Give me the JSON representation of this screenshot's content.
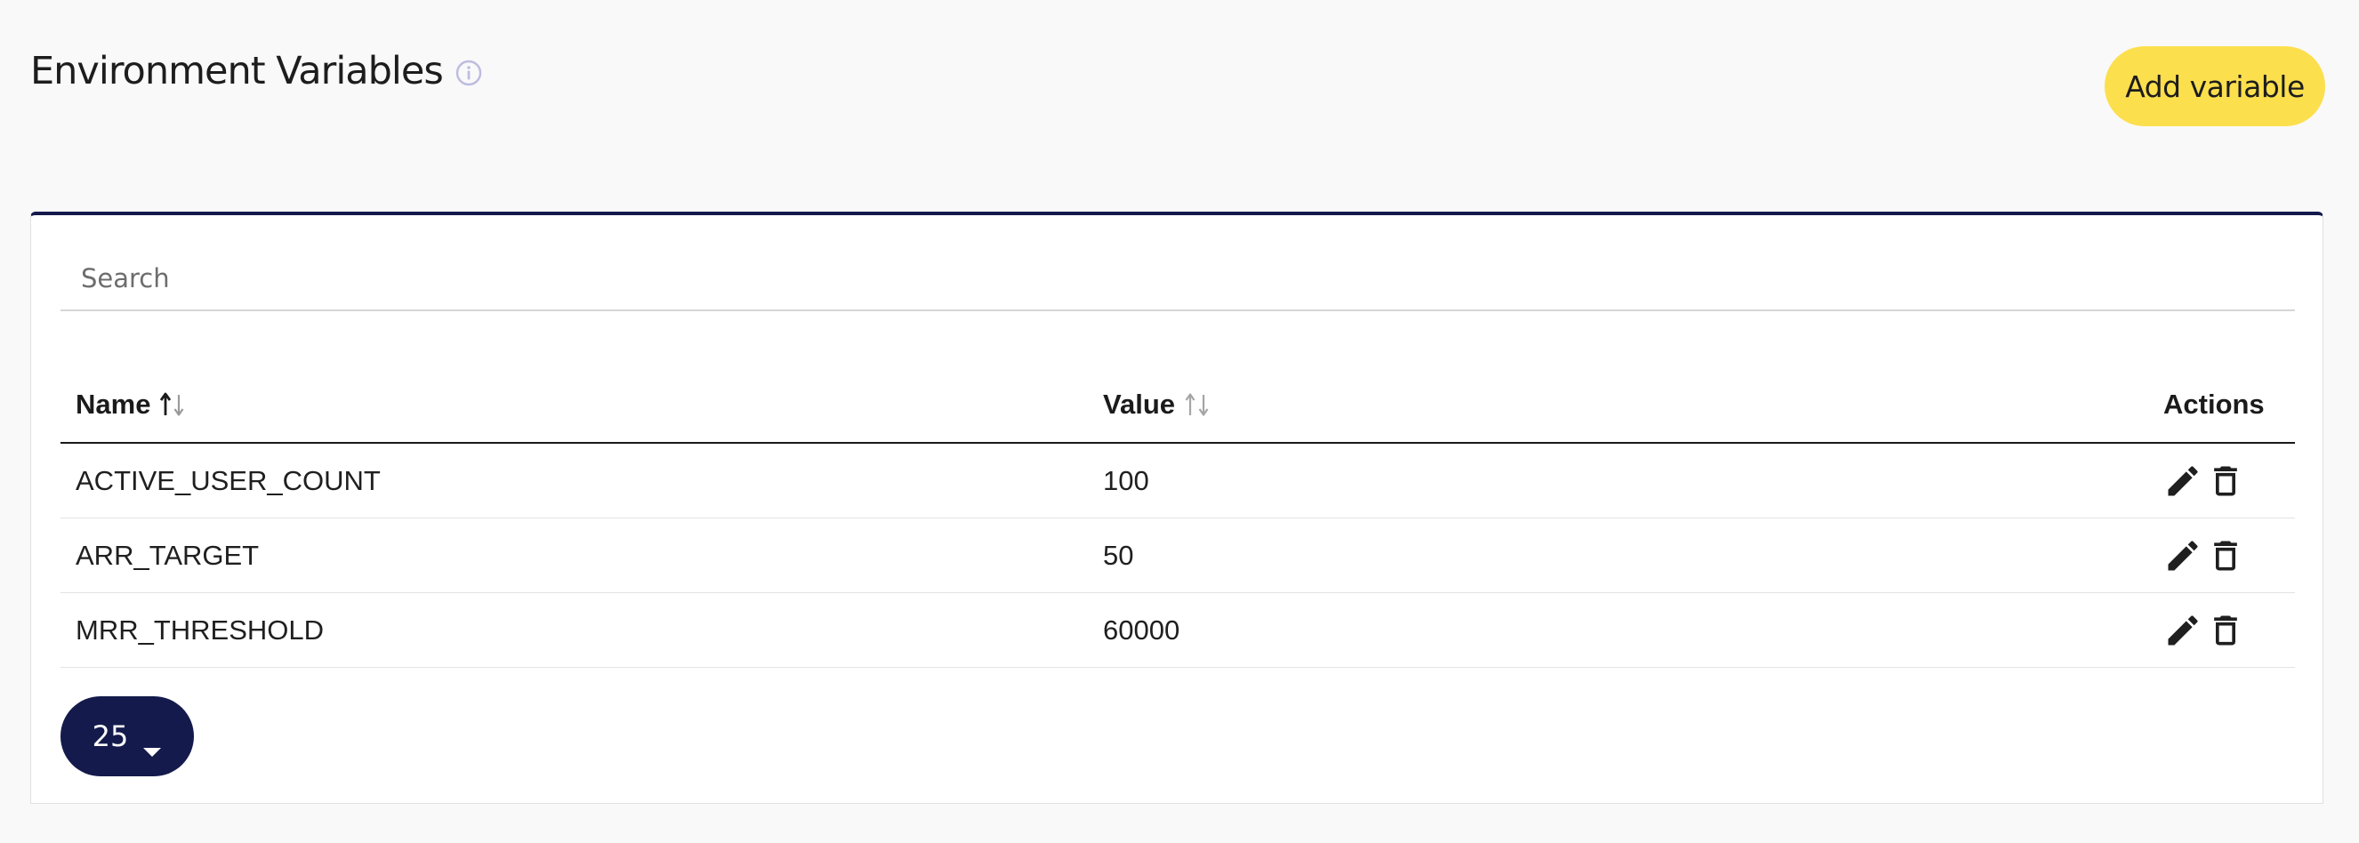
{
  "header": {
    "title": "Environment Variables",
    "info_icon": "info-icon",
    "add_button_label": "Add variable"
  },
  "colors": {
    "accent_navy": "#141a4b",
    "button_yellow": "#fcdf4d",
    "background": "#faf9f9"
  },
  "search": {
    "placeholder": "Search",
    "value": ""
  },
  "table": {
    "columns": {
      "name": "Name",
      "value": "Value",
      "actions": "Actions"
    },
    "sort": {
      "column": "name",
      "direction": "ascending"
    },
    "rows": [
      {
        "name": "ACTIVE_USER_COUNT",
        "value": "100"
      },
      {
        "name": "ARR_TARGET",
        "value": "50"
      },
      {
        "name": "MRR_THRESHOLD",
        "value": "60000"
      }
    ],
    "row_action_icons": [
      "edit-icon",
      "delete-icon"
    ]
  },
  "pagination": {
    "page_size": "25"
  }
}
